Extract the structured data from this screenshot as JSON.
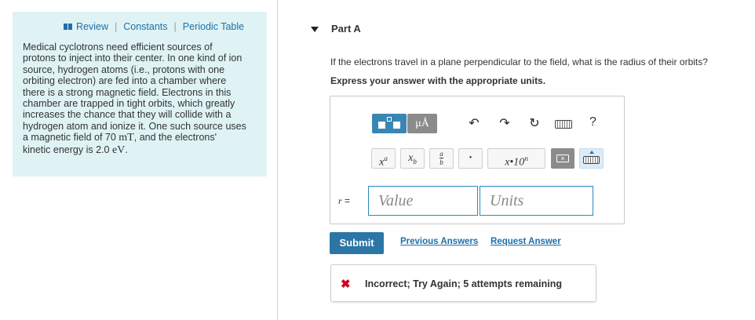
{
  "sidebar": {
    "links": [
      "Review",
      "Constants",
      "Periodic Table"
    ],
    "problem_lines": [
      "Medical cyclotrons need efficient sources of",
      "protons to inject into their center. In one kind of ion",
      "source, hydrogen atoms (i.e., protons with one",
      "orbiting electron) are fed into a chamber where",
      "there is a strong magnetic field. Electrons in this",
      "chamber are trapped in tight orbits, which greatly",
      "increases the chance that they will collide with a",
      "hydrogen atom and ionize it. One such source uses"
    ],
    "line9_before": "a magnetic field of 70 ",
    "line9_unit": "mT",
    "line9_after": ", and the electrons'",
    "line10_before": "kinetic energy is 2.0 ",
    "line10_unit": "eV",
    "line10_after": "."
  },
  "part": {
    "title": "Part A",
    "question": "If the electrons travel in a plane perpendicular to the field, what is the radius of their orbits?",
    "instruction": "Express your answer with the appropriate units."
  },
  "toolbar": {
    "units_button_label": "μÅ",
    "help_label": "?",
    "x_power_base": "x",
    "x_power_exp": "a",
    "x_sub_base": "x",
    "x_sub_index": "b",
    "frac_num": "a",
    "frac_den": "b",
    "dot_label": "•",
    "sci_notation_label": "x•10",
    "sci_notation_exp": "n",
    "backspace_label": "×"
  },
  "answer": {
    "variable": "r",
    "equals": "=",
    "value_placeholder": "Value",
    "units_placeholder": "Units"
  },
  "actions": {
    "submit": "Submit",
    "previous_answers": "Previous Answers",
    "request_answer": "Request Answer"
  },
  "feedback": {
    "message": "Incorrect; Try Again; 5 attempts remaining"
  },
  "colors": {
    "panel_bg": "#dff3f5",
    "accent": "#2b76a6",
    "error": "#d0021b"
  }
}
